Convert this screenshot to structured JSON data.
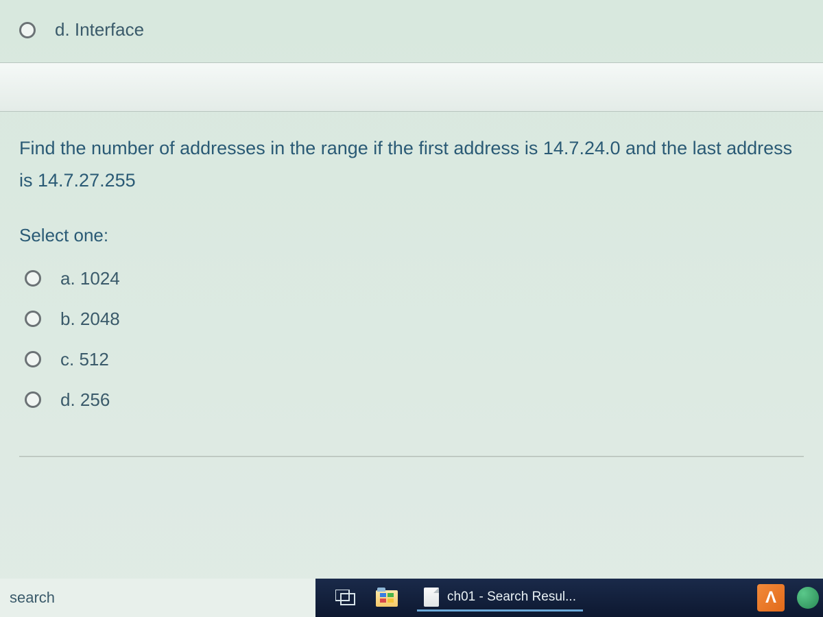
{
  "top_option": {
    "label": "d. Interface"
  },
  "question": {
    "text": "Find the number of addresses in the range if the first address is 14.7.24.0 and the last address is 14.7.27.255",
    "select_prompt": "Select one:",
    "options": [
      {
        "label": "a. 1024"
      },
      {
        "label": "b. 2048"
      },
      {
        "label": "c. 512"
      },
      {
        "label": "d. 256"
      }
    ]
  },
  "taskbar": {
    "search_text": "search",
    "app_label": "ch01 - Search Resul...",
    "orange_glyph": "Λ"
  }
}
